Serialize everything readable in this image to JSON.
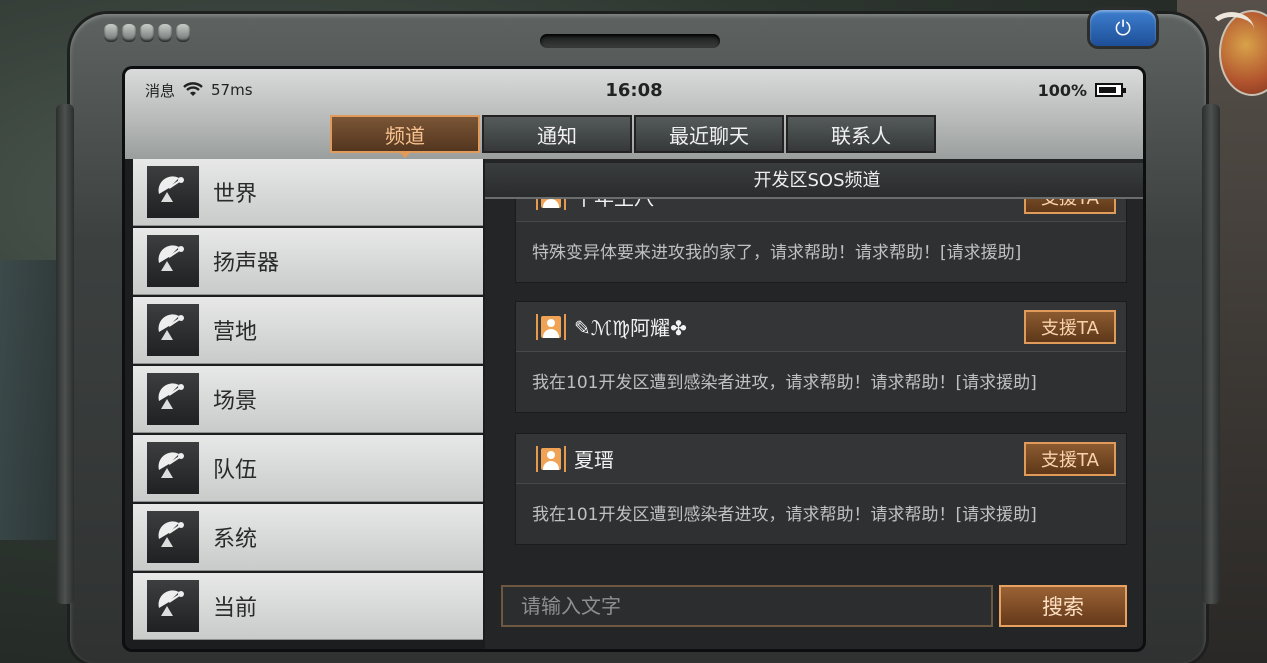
{
  "statusbar": {
    "left_label": "消息",
    "ping": "57ms",
    "time": "16:08",
    "battery": "100%"
  },
  "tabs": [
    {
      "label": "频道",
      "active": true
    },
    {
      "label": "通知",
      "active": false
    },
    {
      "label": "最近聊天",
      "active": false
    },
    {
      "label": "联系人",
      "active": false
    }
  ],
  "sidebar": {
    "items": [
      {
        "label": "世界",
        "icon": "satellite-dish-icon"
      },
      {
        "label": "扬声器",
        "icon": "satellite-dish-icon"
      },
      {
        "label": "营地",
        "icon": "satellite-dish-icon"
      },
      {
        "label": "场景",
        "icon": "satellite-dish-icon"
      },
      {
        "label": "队伍",
        "icon": "satellite-dish-icon"
      },
      {
        "label": "系统",
        "icon": "satellite-dish-icon"
      },
      {
        "label": "当前",
        "icon": "satellite-dish-icon"
      }
    ]
  },
  "channel": {
    "title": "开发区SOS频道",
    "messages": [
      {
        "name": "千年王八",
        "text": "特殊变异体要来进攻我的家了，请求帮助！请求帮助！[请求援助]",
        "action": "支援TA"
      },
      {
        "name": "✎ℳ♍阿耀✤",
        "text": "我在101开发区遭到感染者进攻，请求帮助！请求帮助！[请求援助]",
        "action": "支援TA"
      },
      {
        "name": "夏瑨",
        "text": "我在101开发区遭到感染者进攻，请求帮助！请求帮助！[请求援助]",
        "action": "支援TA"
      }
    ]
  },
  "input": {
    "placeholder": "请输入文字",
    "button_label": "搜索"
  },
  "colors": {
    "accent": "#e09a5a",
    "power_button": "#2f6cc0"
  }
}
